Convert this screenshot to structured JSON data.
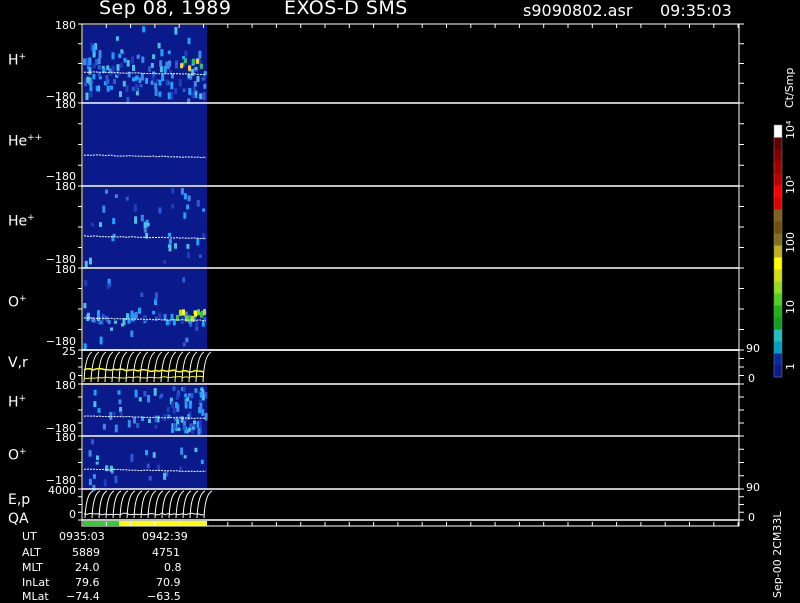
{
  "header": {
    "date": "Sep 08, 1989",
    "instrument": "EXOS-D SMS",
    "file": "s9090802.asr",
    "time": "09:35:03"
  },
  "colors": {
    "background": "#000000",
    "panel_fill": "#0a1a8a",
    "trace": "#ffffff",
    "yellow_trace": "#ffff00",
    "qa_green": "#33cc33",
    "qa_yellow": "#ffff00"
  },
  "colorbar": {
    "unit": "Ct/Smp",
    "ticks": [
      "1",
      "10",
      "100",
      "10³",
      "10⁴"
    ],
    "colors": [
      "#0a1a8a",
      "#0a2aa0",
      "#00a0c0",
      "#20c0c0",
      "#10a020",
      "#20b020",
      "#50d020",
      "#90e020",
      "#d0e010",
      "#ffff00",
      "#c0b020",
      "#807020",
      "#705010",
      "#806020",
      "#e00000",
      "#ff0000",
      "#c00000",
      "#a00000",
      "#800000",
      "#600000",
      "#ffffff"
    ]
  },
  "panels": [
    {
      "label": "H",
      "sup": "+",
      "ytop": "180",
      "ybot": "−180"
    },
    {
      "label": "He",
      "sup": "++",
      "ytop": "180",
      "ybot": "−180"
    },
    {
      "label": "He",
      "sup": "+",
      "ytop": "180",
      "ybot": "−180"
    },
    {
      "label": "O",
      "sup": "+",
      "ytop": "180",
      "ybot": "−180"
    },
    {
      "label": "V,r",
      "sup": "",
      "ytop": "25",
      "ybot": "0",
      "rtop": "90",
      "rbot": "0"
    },
    {
      "label": "H",
      "sup": "+",
      "ytop": "180",
      "ybot": "−180"
    },
    {
      "label": "O",
      "sup": "+",
      "ytop": "180",
      "ybot": "−180"
    },
    {
      "label": "E,p",
      "sup": "",
      "ytop": "4000",
      "ybot": "0",
      "rtop": "90",
      "rbot": "0"
    },
    {
      "label": "QA",
      "sup": "",
      "ytop": "",
      "ybot": ""
    }
  ],
  "footer": {
    "rows": [
      {
        "name": "UT",
        "v1": "0935:03",
        "v2": "0942:39"
      },
      {
        "name": "ALT",
        "v1": "5889",
        "v2": "4751"
      },
      {
        "name": "MLT",
        "v1": "24.0",
        "v2": "0.8"
      },
      {
        "name": "InLat",
        "v1": "79.6",
        "v2": "70.9"
      },
      {
        "name": "MLat",
        "v1": "−74.4",
        "v2": "−63.5"
      }
    ],
    "version": "Sep-00 2CM33L"
  },
  "chart_data": {
    "type": "heatmap",
    "title": "Sep 08, 1989    EXOS-D SMS",
    "x": [
      "0935:03",
      "0942:39"
    ],
    "series": [
      {
        "name": "H+",
        "ylim": [
          -180,
          180
        ]
      },
      {
        "name": "He++",
        "ylim": [
          -180,
          180
        ]
      },
      {
        "name": "He+",
        "ylim": [
          -180,
          180
        ]
      },
      {
        "name": "O+",
        "ylim": [
          -180,
          180
        ]
      },
      {
        "name": "V,r",
        "ylim": [
          0,
          25
        ],
        "right_ylim": [
          0,
          90
        ]
      },
      {
        "name": "H+",
        "ylim": [
          -180,
          180
        ]
      },
      {
        "name": "O+",
        "ylim": [
          -180,
          180
        ]
      },
      {
        "name": "E,p",
        "ylim": [
          0,
          4000
        ],
        "right_ylim": [
          0,
          90
        ]
      }
    ],
    "colorbar_unit": "Ct/Smp",
    "colorbar_range": [
      1,
      10000
    ],
    "qa": [
      {
        "color": "#33cc33",
        "fraction": 0.29
      },
      {
        "color": "#ffff00",
        "fraction": 0.71
      }
    ]
  }
}
